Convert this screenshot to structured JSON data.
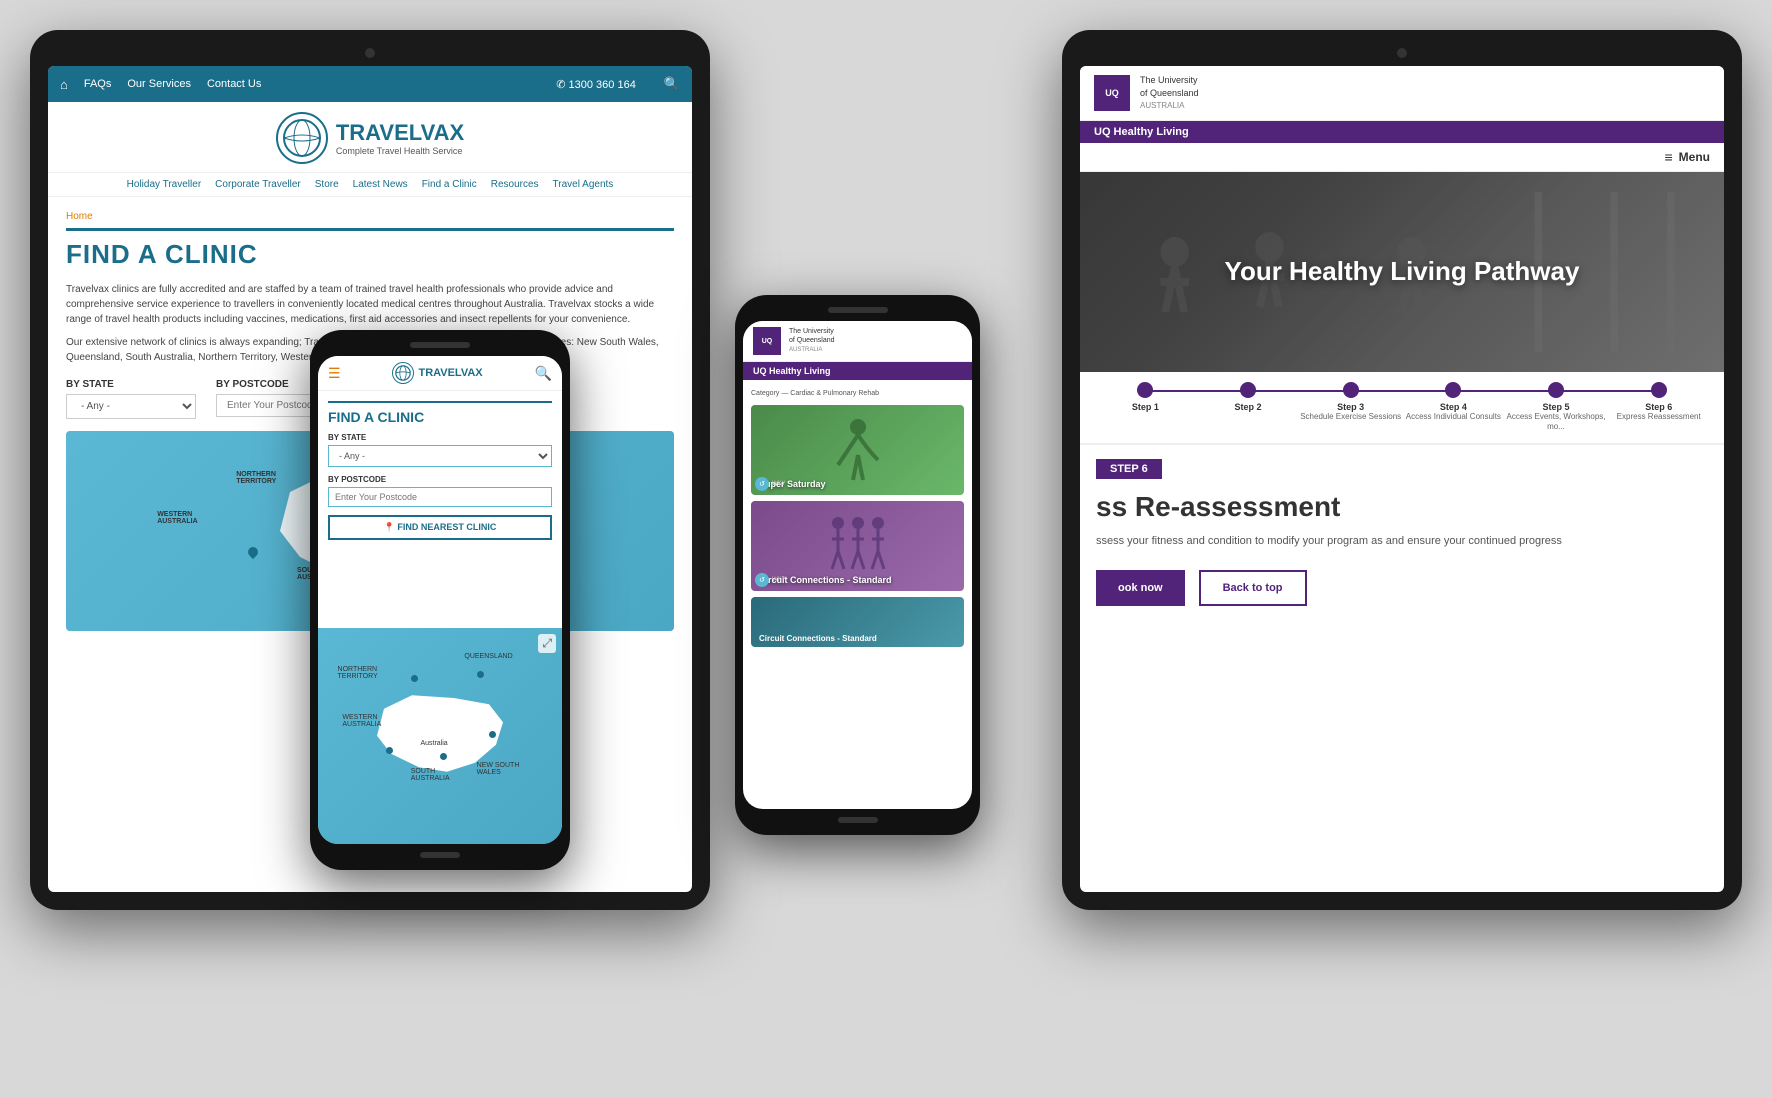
{
  "scene": {
    "bg_color": "#d8d8d8"
  },
  "tablet_left": {
    "topbar": {
      "home_label": "⌂",
      "faqs": "FAQs",
      "our_services": "Our Services",
      "contact_us": "Contact Us",
      "phone": "✆ 1300 360 164",
      "search_icon": "🔍"
    },
    "logo": {
      "brand": "TRAVELVAX",
      "tagline": "Complete Travel Health Service"
    },
    "nav": {
      "items": [
        "Holiday Traveller",
        "Corporate Traveller",
        "Store",
        "Latest News",
        "Find a Clinic",
        "Resources",
        "Travel Agents"
      ]
    },
    "breadcrumb": "Home",
    "page_title": "FIND A CLINIC",
    "body_text_1": "Travelvax clinics are fully accredited and are staffed by a team of trained travel health professionals who provide advice and comprehensive service experience to travellers in conveniently located medical centres throughout Australia. Travelvax stocks a wide range of travel health products including vaccines, medications, first aid accessories and insect repellents for your convenience.",
    "body_text_2": "Our extensive network of clinics is always expanding; Travelvax Clinics are currently located in the following states: New South Wales, Queensland, South Australia, Northern Territory, Western Australia and Tasmania.",
    "filter_state_label": "BY STATE",
    "filter_postcode_label": "BY POSTCODE",
    "filter_state_placeholder": "- Any -",
    "filter_postcode_placeholder": "Enter Your Postcode"
  },
  "phone_left": {
    "topbar": {
      "hamburger": "☰",
      "brand": "TRAVELVAX",
      "search": "🔍"
    },
    "page_title": "FIND A CLINIC",
    "state_label": "BY STATE",
    "state_placeholder": "- Any -",
    "postcode_label": "BY POSTCODE",
    "postcode_placeholder": "Enter Your Postcode",
    "find_btn": "📍 FIND NEAREST CLINIC",
    "map_labels": {
      "northern_territory": "NORTHERN\nTERRITORY",
      "queensland": "QUEENSLAND",
      "western_australia": "WESTERN\nAUSTRALIA",
      "south_australia": "SOUTH\nAUSTRALIA",
      "australia": "Australia",
      "new_south_wales": "NEW SOUTH\nWALES"
    }
  },
  "phone_right": {
    "logo_text": "UQ",
    "org_name": "The University\nof Queensland\nAUSTRALIA",
    "section": "UQ Healthy Living",
    "category_label": "Category — Cardiac & Pulmonary Rehab",
    "cards": [
      {
        "label": "Super Saturday",
        "color": "purple",
        "icon": "↺",
        "sub": "WKY"
      },
      {
        "label": "Circuit Connections - Standard",
        "color": "teal",
        "icon": "↺",
        "sub": "WKY"
      }
    ]
  },
  "tablet_right": {
    "logo_text": "UQ",
    "org_name": "The University\nof Queensland\nAUSTRALIA",
    "section": "UQ Healthy Living",
    "hero_title": "Your Healthy Living Pathway",
    "menu_label": "Menu",
    "steps": [
      {
        "number": "Step 1",
        "desc": "",
        "state": "done"
      },
      {
        "number": "Step 2",
        "desc": "",
        "state": "done"
      },
      {
        "number": "Step 3",
        "desc": "Schedule Exercise Sessions",
        "state": "done"
      },
      {
        "number": "Step 4",
        "desc": "Access Individual Consults",
        "state": "done"
      },
      {
        "number": "Step 5",
        "desc": "Access Events, Workshops, mo...",
        "state": "done"
      },
      {
        "number": "Step 6",
        "desc": "Express Reassessment",
        "state": "active"
      }
    ],
    "step_badge": "STEP 6",
    "step_title": "ss Re-assessment",
    "step_text": "ssess your fitness and condition to modify your program as\nand ensure your continued progress",
    "book_btn": "ook now",
    "back_btn": "Back to top"
  }
}
